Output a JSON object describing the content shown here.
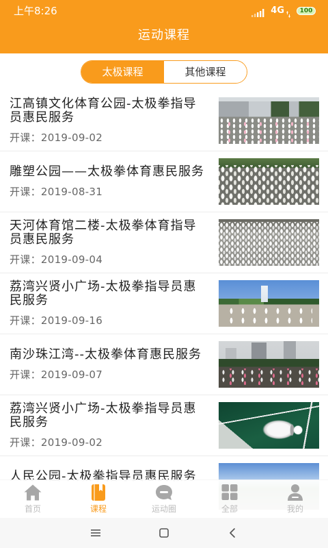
{
  "status_bar": {
    "time": "上午8:26",
    "network": "4G",
    "battery": "100",
    "icons": [
      "signal-icon",
      "data-arrows-icon",
      "battery-icon"
    ]
  },
  "header": {
    "title": "运动课程"
  },
  "tabs": [
    {
      "label": "太极课程",
      "active": true
    },
    {
      "label": "其他课程",
      "active": false
    }
  ],
  "courses": {
    "items": [
      {
        "title": "江高镇文化体育公园-太极拳指导员惠民服务",
        "date": "开课：2019-09-02"
      },
      {
        "title": "雕塑公园——太极拳体育惠民服务",
        "date": "开课：2019-08-31"
      },
      {
        "title": "天河体育馆二楼-太极拳体育指导员惠民服务",
        "date": "开课：2019-09-04"
      },
      {
        "title": "荔湾兴贤小广场-太极拳指导员惠民服务",
        "date": "开课：2019-09-16"
      },
      {
        "title": "南沙珠江湾--太极拳体育惠民服务",
        "date": "开课：2019-09-07"
      },
      {
        "title": "荔湾兴贤小广场-太极拳指导员惠民服务",
        "date": "开课：2019-09-02"
      },
      {
        "title": "人民公园-太极拳指导员惠民服务"
      }
    ]
  },
  "bottom_nav": {
    "items": [
      {
        "label": "首页",
        "icon": "home-icon",
        "active": false
      },
      {
        "label": "课程",
        "icon": "book-icon",
        "active": true
      },
      {
        "label": "运动圈",
        "icon": "chat-bubble-icon",
        "active": false
      },
      {
        "label": "全部",
        "icon": "grid-icon",
        "active": false
      },
      {
        "label": "我的",
        "icon": "person-icon",
        "active": false
      }
    ]
  },
  "system_nav": {
    "buttons": [
      "menu-icon",
      "home-square-icon",
      "back-icon"
    ]
  },
  "colors": {
    "accent": "#F99B1C",
    "text": "#222222",
    "muted": "#666666",
    "divider": "#ECECEC"
  }
}
